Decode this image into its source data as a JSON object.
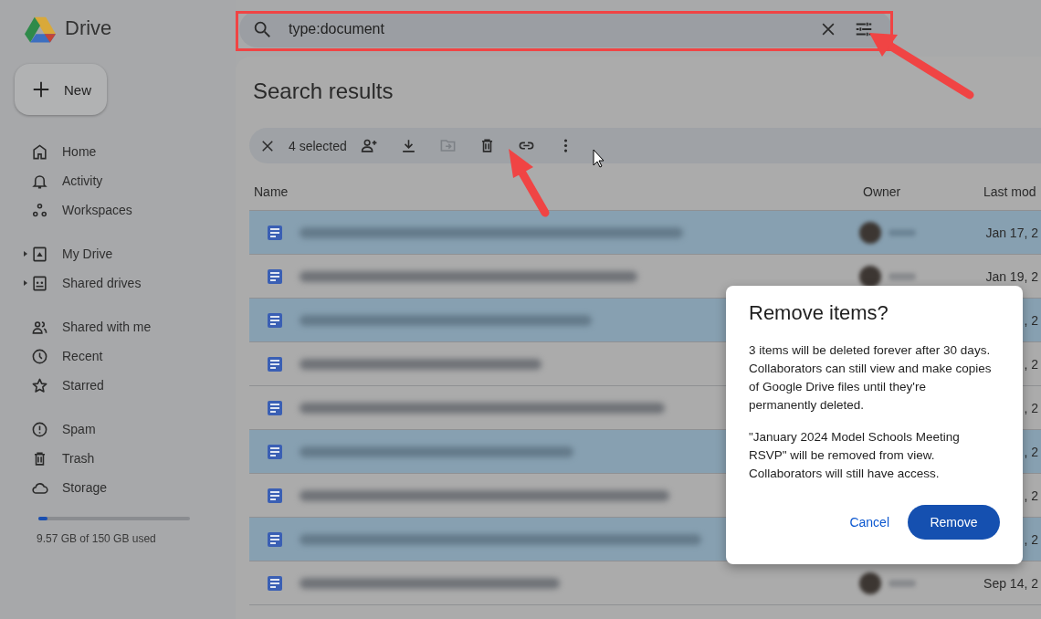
{
  "app": {
    "name": "Drive"
  },
  "new_button": {
    "label": "New"
  },
  "sidebar": {
    "sections": [
      {
        "items": [
          {
            "label": "Home",
            "expandable": false
          },
          {
            "label": "Activity",
            "expandable": false
          },
          {
            "label": "Workspaces",
            "expandable": false
          }
        ]
      },
      {
        "items": [
          {
            "label": "My Drive",
            "expandable": true
          },
          {
            "label": "Shared drives",
            "expandable": true
          }
        ]
      },
      {
        "items": [
          {
            "label": "Shared with me",
            "expandable": false
          },
          {
            "label": "Recent",
            "expandable": false
          },
          {
            "label": "Starred",
            "expandable": false
          }
        ]
      },
      {
        "items": [
          {
            "label": "Spam",
            "expandable": false
          },
          {
            "label": "Trash",
            "expandable": false
          },
          {
            "label": "Storage",
            "expandable": false
          }
        ]
      }
    ]
  },
  "storage": {
    "level": 0.06,
    "text": "9.57 GB of 150 GB used"
  },
  "search": {
    "value": "type:document"
  },
  "page_title": "Search results",
  "selection_bar": {
    "count": "4 selected",
    "actions": [
      {
        "disabled": false
      },
      {
        "disabled": false
      },
      {
        "disabled": true
      },
      {
        "disabled": false
      },
      {
        "disabled": false
      },
      {
        "disabled": false
      }
    ]
  },
  "table": {
    "columns": [
      "Name",
      "Owner",
      "Last mod"
    ],
    "rows": [
      {
        "selected": true,
        "last_modified": "Jan 17, 2"
      },
      {
        "selected": false,
        "last_modified": "Jan 19, 2"
      },
      {
        "selected": true,
        "last_modified": ", 2"
      },
      {
        "selected": false,
        "last_modified": ", 2"
      },
      {
        "selected": false,
        "last_modified": ", 2"
      },
      {
        "selected": true,
        "last_modified": ", 2"
      },
      {
        "selected": false,
        "last_modified": ", 2"
      },
      {
        "selected": true,
        "last_modified": ", 2"
      },
      {
        "selected": false,
        "last_modified": "Sep 14, 2"
      }
    ]
  },
  "dialog": {
    "title": "Remove items?",
    "paragraphs": [
      "3 items will be deleted forever after 30 days. Collaborators can still view and make copies of Google Drive files until they're permanently deleted.",
      "\"January 2024 Model Schools Meeting RSVP\" will be removed from view. Collaborators will still have access."
    ],
    "buttons": [
      {
        "label": "Cancel",
        "kind": "text"
      },
      {
        "label": "Remove",
        "kind": "filled"
      }
    ]
  }
}
